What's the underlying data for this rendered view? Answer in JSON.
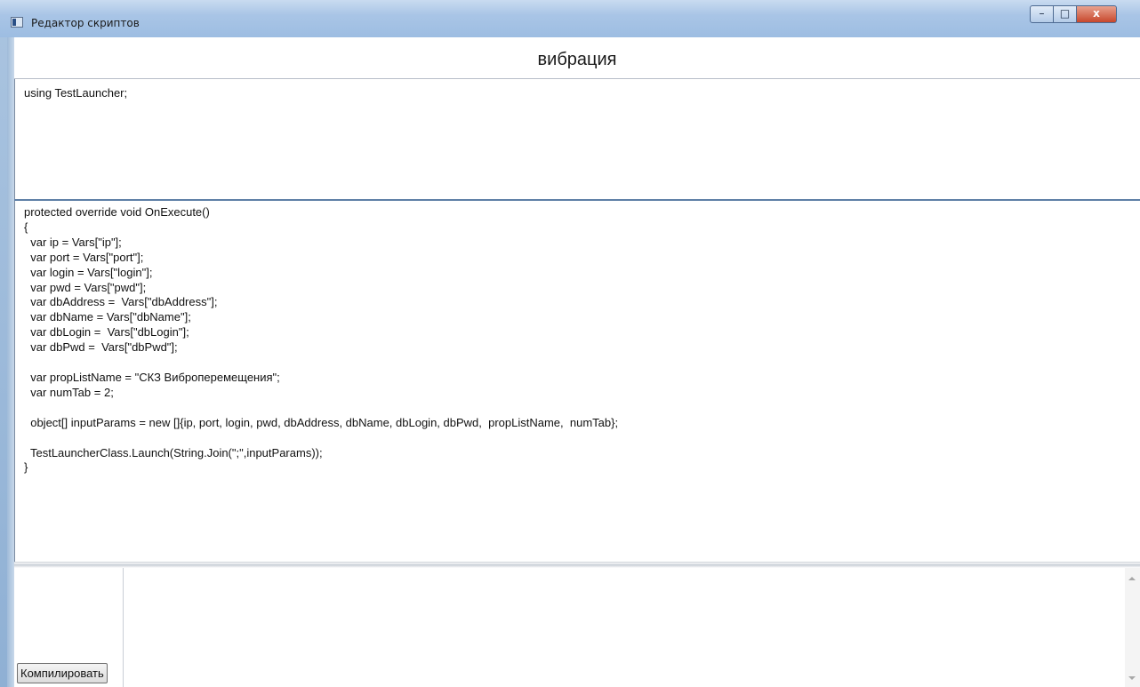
{
  "window": {
    "title": "Редактор скриптов",
    "controls": {
      "minimize": "–",
      "maximize": "□",
      "close": "x"
    }
  },
  "header": {
    "script_name": "вибрация"
  },
  "usings": {
    "text": "using TestLauncher;"
  },
  "code": {
    "text": "protected override void OnExecute()\n{\n  var ip = Vars[\"ip\"];\n  var port = Vars[\"port\"];\n  var login = Vars[\"login\"];\n  var pwd = Vars[\"pwd\"];\n  var dbAddress =  Vars[\"dbAddress\"];\n  var dbName = Vars[\"dbName\"];\n  var dbLogin =  Vars[\"dbLogin\"];\n  var dbPwd =  Vars[\"dbPwd\"];\n\n  var propListName = \"СКЗ Виброперемещения\";\n  var numTab = 2;\n\n  object[] inputParams = new []{ip, port, login, pwd, dbAddress, dbName, dbLogin, dbPwd,  propListName,  numTab};\n\n  TestLauncherClass.Launch(String.Join(\";\",inputParams));\n}"
  },
  "bottom": {
    "compile_label": "Компилировать",
    "output_text": ""
  }
}
